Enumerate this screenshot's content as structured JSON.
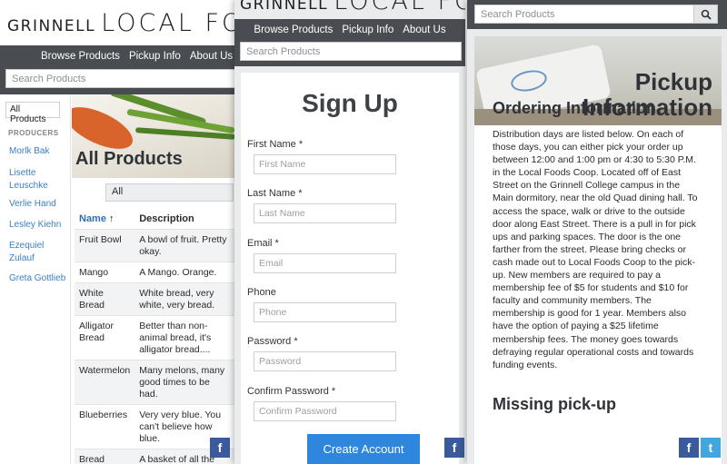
{
  "logo": {
    "prefix": "GRINNELL",
    "main": "LOCAL FOODS"
  },
  "nav": {
    "items": [
      "Browse Products",
      "Pickup Info",
      "About Us"
    ]
  },
  "search": {
    "placeholder": "Search Products"
  },
  "browse": {
    "sidebar": {
      "all_label": "All Products",
      "heading": "PRODUCERS",
      "producers": [
        "Morlk Bak",
        "Lisette Leuschke",
        "Verlie Hand",
        "Lesley Kiehn",
        "Ezequiel Zulauf",
        "Greta Gottlieb"
      ]
    },
    "hero_title": "All Products",
    "filter_value": "All",
    "table": {
      "headers": {
        "name": "Name",
        "sort_icon": "↑",
        "description": "Description"
      },
      "rows": [
        {
          "name": "Fruit Bowl",
          "description": "A bowl of fruit. Pretty okay."
        },
        {
          "name": "Mango",
          "description": "A Mango. Orange."
        },
        {
          "name": "White Bread",
          "description": "White bread, very white, very bread."
        },
        {
          "name": "Alligator Bread",
          "description": "Better than non-animal bread, it's alligator bread...."
        },
        {
          "name": "Watermelon",
          "description": "Many melons, many good times to be had."
        },
        {
          "name": "Blueberries",
          "description": "Very very blue. You can't believe how blue."
        },
        {
          "name": "Bread",
          "description": "A basket of all the"
        }
      ]
    }
  },
  "signup": {
    "title": "Sign Up",
    "fields": [
      {
        "label": "First Name *",
        "placeholder": "First Name"
      },
      {
        "label": "Last Name *",
        "placeholder": "Last Name"
      },
      {
        "label": "Email *",
        "placeholder": "Email"
      },
      {
        "label": "Phone",
        "placeholder": "Phone"
      },
      {
        "label": "Password *",
        "placeholder": "Password"
      },
      {
        "label": "Confirm Password *",
        "placeholder": "Confirm Password"
      }
    ],
    "submit_label": "Create Account"
  },
  "pickup": {
    "title_line1": "Pickup",
    "title_line2": "Information",
    "ordering_heading": "Ordering Information",
    "ordering_text": "Distribution days are listed below. On each of those days, you can either pick your order up between 12:00 and 1:00 pm or 4:30 to 5:30 P.M. in the Local Foods Coop. Located off of East Street on the Grinnell College campus in the Main dormitory, near the old Quad dining hall. To access the space, walk or drive to the outside door along East Street. There is a pull in for pick ups and parking spaces. The door is the one farther from the street. Please bring checks or cash made out to Local Foods Coop to the pick-up. New members are required to pay a membership fee of $5 for students and $10 for faculty and community members. The membership is good for 1 year. Members also have the option of paying a $25 lifetime membership fees. The money goes towards defraying regular operational costs and towards funding events.",
    "missing_heading": "Missing pick-up"
  },
  "social": {
    "facebook": "f",
    "twitter": "t"
  },
  "colors": {
    "nav": "#494d51",
    "link": "#3a7fc4",
    "button": "#2f87dd",
    "facebook": "#3b5a9b",
    "twitter": "#43a7df"
  }
}
